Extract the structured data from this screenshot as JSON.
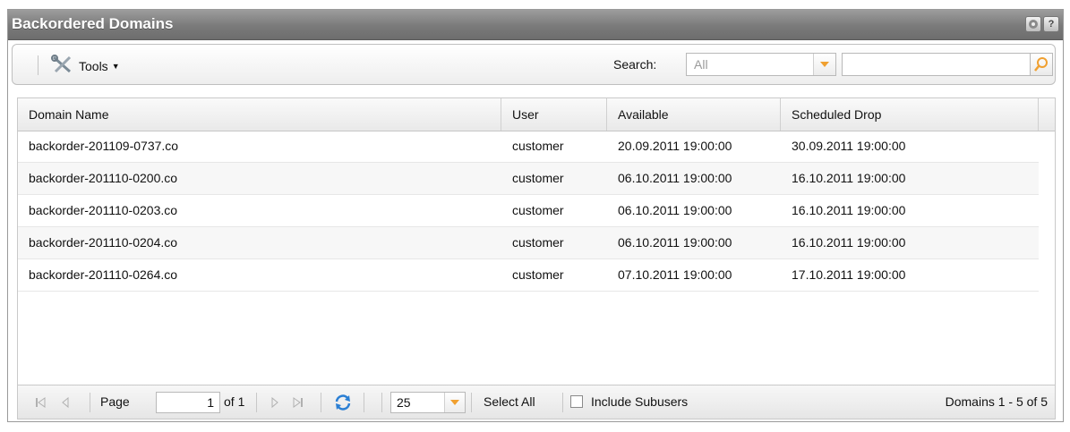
{
  "panel": {
    "title": "Backordered Domains",
    "icons": [
      "settings-icon",
      "help-icon"
    ],
    "help_glyph": "?"
  },
  "toolbar": {
    "tools_label": "Tools",
    "search_label": "Search:",
    "search_scope": "All",
    "search_value": ""
  },
  "grid": {
    "columns": [
      "Domain Name",
      "User",
      "Available",
      "Scheduled Drop"
    ],
    "rows": [
      {
        "domain": "backorder-201109-0737.co",
        "user": "customer",
        "available": "20.09.2011 19:00:00",
        "drop": "30.09.2011 19:00:00"
      },
      {
        "domain": "backorder-201110-0200.co",
        "user": "customer",
        "available": "06.10.2011 19:00:00",
        "drop": "16.10.2011 19:00:00"
      },
      {
        "domain": "backorder-201110-0203.co",
        "user": "customer",
        "available": "06.10.2011 19:00:00",
        "drop": "16.10.2011 19:00:00"
      },
      {
        "domain": "backorder-201110-0204.co",
        "user": "customer",
        "available": "06.10.2011 19:00:00",
        "drop": "16.10.2011 19:00:00"
      },
      {
        "domain": "backorder-201110-0264.co",
        "user": "customer",
        "available": "07.10.2011 19:00:00",
        "drop": "17.10.2011 19:00:00"
      }
    ]
  },
  "paging": {
    "page_label": "Page",
    "page_value": "1",
    "of_label": "of 1",
    "page_size": "25",
    "select_all": "Select All",
    "include_subusers": "Include Subusers",
    "include_subusers_checked": false,
    "summary": "Domains 1 - 5 of 5"
  },
  "colors": {
    "title_bar": "#7a7a7a",
    "accent_orange": "#f0a030",
    "refresh_blue": "#2b7fd4"
  }
}
